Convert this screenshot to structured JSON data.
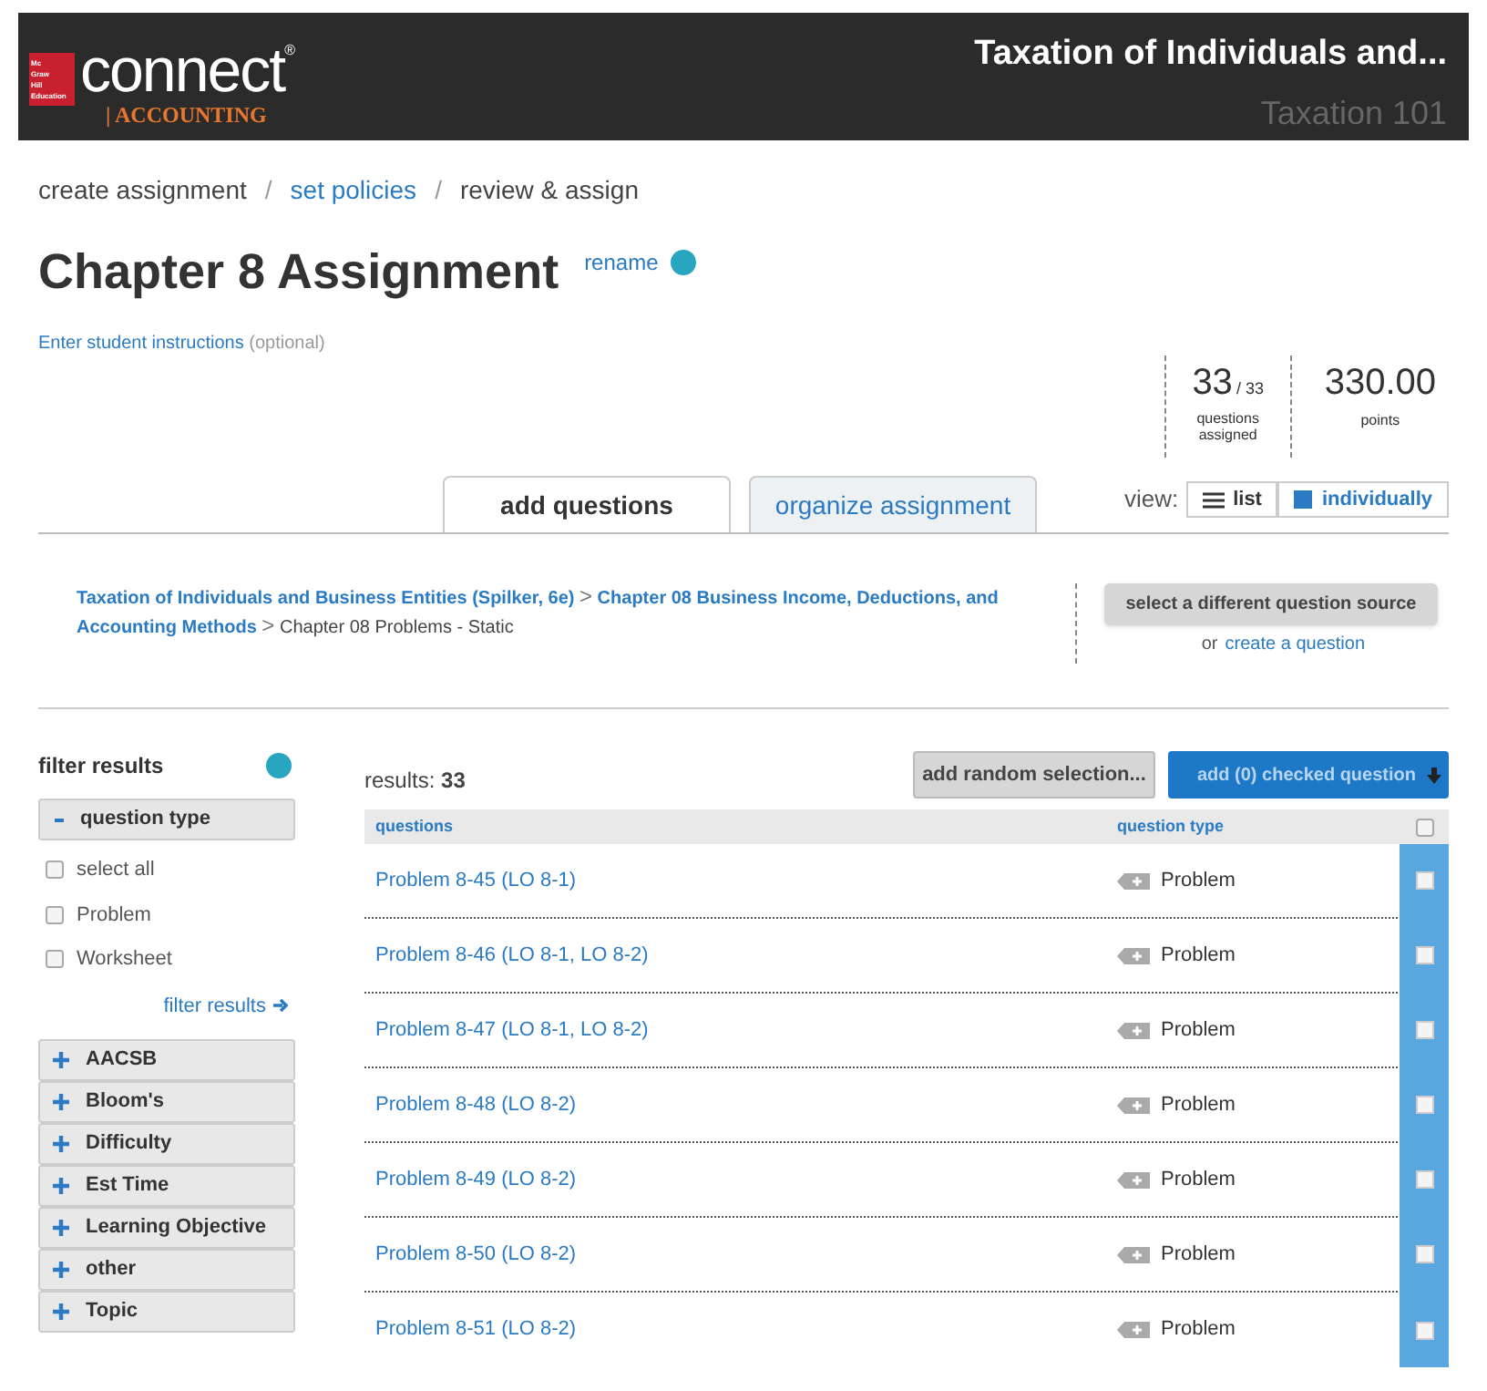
{
  "header": {
    "brand": "connect",
    "brand_mark": "®",
    "product": "| ACCOUNTING",
    "logo_lines": [
      "Mc",
      "Graw",
      "Hill",
      "Education"
    ],
    "course_title": "Taxation of Individuals and...",
    "course_name": "Taxation 101"
  },
  "steps": [
    {
      "label": "create assignment",
      "link": false
    },
    {
      "label": "set policies",
      "link": true
    },
    {
      "label": "review & assign",
      "link": false
    }
  ],
  "step_separator": "/",
  "title": "Chapter 8 Assignment",
  "rename": "rename",
  "instructions": {
    "link": "Enter student instructions",
    "note": "(optional)"
  },
  "stats": {
    "assigned": "33",
    "total": "/ 33",
    "assigned_label": "questions assigned",
    "points": "330.00",
    "points_label": "points"
  },
  "tabs": [
    {
      "label": "add questions",
      "selected": true
    },
    {
      "label": "organize assignment",
      "selected": false
    }
  ],
  "view": {
    "label": "view:",
    "options": [
      {
        "label": "list",
        "selected": false
      },
      {
        "label": "individually",
        "selected": true
      }
    ]
  },
  "source": {
    "path": [
      {
        "label": "Taxation of Individuals and Business Entities (Spilker, 6e)",
        "link": true
      },
      {
        "label": "Chapter 08 Business Income, Deductions, and Accounting Methods",
        "link": true
      },
      {
        "label": "Chapter 08 Problems - Static",
        "link": false
      }
    ],
    "separator": ">",
    "button": "select a different question source",
    "or": "or",
    "create": "create a question"
  },
  "filter": {
    "title": "filter results",
    "group": "question type",
    "options": [
      {
        "label": "select all",
        "checked": false
      },
      {
        "label": "Problem",
        "checked": false
      },
      {
        "label": "Worksheet",
        "checked": false
      }
    ],
    "apply": "filter results",
    "sections": [
      "AACSB",
      "Bloom's",
      "Difficulty",
      "Est Time",
      "Learning Objective",
      "other",
      "Topic"
    ]
  },
  "results": {
    "label": "results:",
    "count": "33",
    "random_button": "add random selection...",
    "add_button": "add (0) checked question",
    "columns": [
      "questions",
      "question type"
    ],
    "all_checked": false,
    "rows": [
      {
        "question": "Problem 8-45 (LO 8-1)",
        "type": "Problem",
        "checked": false
      },
      {
        "question": "Problem 8-46 (LO 8-1, LO 8-2)",
        "type": "Problem",
        "checked": false
      },
      {
        "question": "Problem 8-47 (LO 8-1, LO 8-2)",
        "type": "Problem",
        "checked": false
      },
      {
        "question": "Problem 8-48 (LO 8-2)",
        "type": "Problem",
        "checked": false
      },
      {
        "question": "Problem 8-49 (LO 8-2)",
        "type": "Problem",
        "checked": false
      },
      {
        "question": "Problem 8-50 (LO 8-2)",
        "type": "Problem",
        "checked": false
      },
      {
        "question": "Problem 8-51 (LO 8-2)",
        "type": "Problem",
        "checked": false
      }
    ]
  }
}
